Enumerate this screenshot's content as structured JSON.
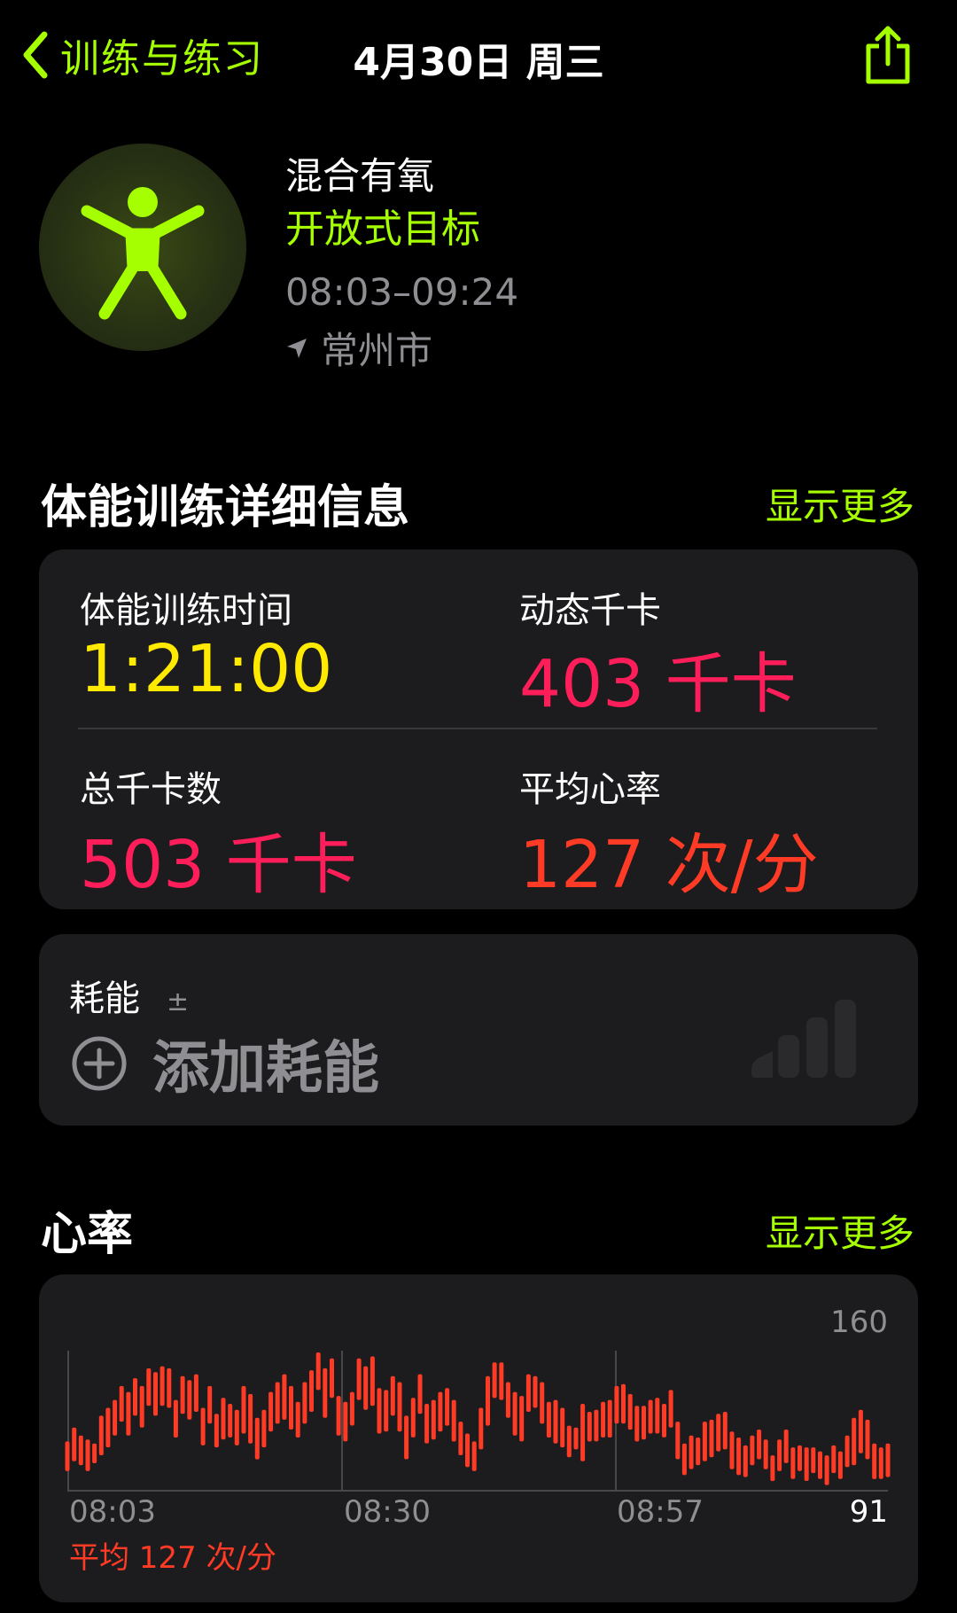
{
  "nav": {
    "back_label": "训练与练习",
    "title": "4月30日 周三"
  },
  "workout": {
    "name": "混合有氧",
    "goal": "开放式目标",
    "time_range": "08:03–09:24",
    "location": "常州市"
  },
  "details": {
    "section_title": "体能训练详细信息",
    "show_more": "显示更多",
    "metrics": [
      {
        "label": "体能训练时间",
        "value": "1:21:00"
      },
      {
        "label": "动态千卡",
        "value": "403 千卡"
      },
      {
        "label": "总千卡数",
        "value": "503 千卡"
      },
      {
        "label": "平均心率",
        "value": "127 次/分"
      }
    ]
  },
  "effort": {
    "label": "耗能",
    "pm": "±",
    "add_label": "添加耗能"
  },
  "heart_rate": {
    "section_title": "心率",
    "show_more": "显示更多",
    "average_label": "平均 127 次/分"
  },
  "colors": {
    "accent": "#a6ff00",
    "duration": "#ffea00",
    "calories": "#ff1e5a",
    "heart": "#ff3b25",
    "card": "#1c1c1e"
  },
  "chart_data": {
    "type": "bar",
    "x_tick_labels": [
      "08:03",
      "08:30",
      "08:57"
    ],
    "y_max_label": "160",
    "y_min_label": "91",
    "ylim": [
      91,
      160
    ],
    "series": [
      {
        "ranges": [
          [
            100,
            115
          ],
          [
            105,
            122
          ],
          [
            103,
            118
          ],
          [
            100,
            116
          ],
          [
            104,
            114
          ],
          [
            108,
            128
          ],
          [
            112,
            132
          ],
          [
            118,
            136
          ],
          [
            125,
            143
          ],
          [
            118,
            140
          ],
          [
            128,
            147
          ],
          [
            122,
            143
          ],
          [
            133,
            152
          ],
          [
            128,
            150
          ],
          [
            133,
            153
          ],
          [
            132,
            152
          ],
          [
            117,
            136
          ],
          [
            129,
            148
          ],
          [
            126,
            146
          ],
          [
            130,
            149
          ],
          [
            113,
            132
          ],
          [
            124,
            143
          ],
          [
            112,
            129
          ],
          [
            116,
            137
          ],
          [
            117,
            134
          ],
          [
            113,
            131
          ],
          [
            119,
            143
          ],
          [
            114,
            139
          ],
          [
            106,
            127
          ],
          [
            112,
            131
          ],
          [
            120,
            140
          ],
          [
            124,
            145
          ],
          [
            126,
            149
          ],
          [
            121,
            143
          ],
          [
            117,
            135
          ],
          [
            124,
            145
          ],
          [
            130,
            151
          ],
          [
            141,
            160
          ],
          [
            127,
            152
          ],
          [
            137,
            157
          ],
          [
            118,
            138
          ],
          [
            115,
            135
          ],
          [
            123,
            140
          ],
          [
            136,
            157
          ],
          [
            131,
            153
          ],
          [
            133,
            158
          ],
          [
            119,
            142
          ],
          [
            120,
            141
          ],
          [
            128,
            148
          ],
          [
            120,
            145
          ],
          [
            106,
            128
          ],
          [
            117,
            137
          ],
          [
            129,
            149
          ],
          [
            114,
            134
          ],
          [
            116,
            136
          ],
          [
            120,
            140
          ],
          [
            123,
            142
          ],
          [
            115,
            136
          ],
          [
            108,
            125
          ],
          [
            102,
            119
          ],
          [
            100,
            115
          ],
          [
            111,
            132
          ],
          [
            123,
            148
          ],
          [
            137,
            155
          ],
          [
            136,
            155
          ],
          [
            127,
            145
          ],
          [
            118,
            140
          ],
          [
            115,
            138
          ],
          [
            130,
            149
          ],
          [
            132,
            148
          ],
          [
            124,
            145
          ],
          [
            117,
            135
          ],
          [
            114,
            136
          ],
          [
            112,
            132
          ],
          [
            107,
            123
          ],
          [
            111,
            122
          ],
          [
            105,
            134
          ],
          [
            115,
            130
          ],
          [
            115,
            131
          ],
          [
            117,
            135
          ],
          [
            117,
            136
          ],
          [
            124,
            143
          ],
          [
            124,
            144
          ],
          [
            121,
            139
          ],
          [
            115,
            133
          ],
          [
            116,
            133
          ],
          [
            119,
            136
          ],
          [
            119,
            137
          ],
          [
            117,
            134
          ],
          [
            122,
            141
          ],
          [
            106,
            125
          ],
          [
            98,
            114
          ],
          [
            101,
            118
          ],
          [
            103,
            117
          ],
          [
            105,
            125
          ],
          [
            107,
            126
          ],
          [
            110,
            129
          ],
          [
            111,
            130
          ],
          [
            101,
            120
          ],
          [
            98,
            117
          ],
          [
            97,
            113
          ],
          [
            103,
            118
          ],
          [
            106,
            121
          ],
          [
            101,
            116
          ],
          [
            95,
            108
          ],
          [
            100,
            116
          ],
          [
            104,
            121
          ],
          [
            96,
            112
          ],
          [
            100,
            113
          ],
          [
            95,
            112
          ],
          [
            99,
            112
          ],
          [
            96,
            110
          ],
          [
            93,
            108
          ],
          [
            99,
            113
          ],
          [
            96,
            110
          ],
          [
            102,
            118
          ],
          [
            103,
            127
          ],
          [
            109,
            131
          ],
          [
            106,
            126
          ],
          [
            96,
            114
          ],
          [
            96,
            112
          ],
          [
            97,
            114
          ]
        ]
      }
    ]
  }
}
